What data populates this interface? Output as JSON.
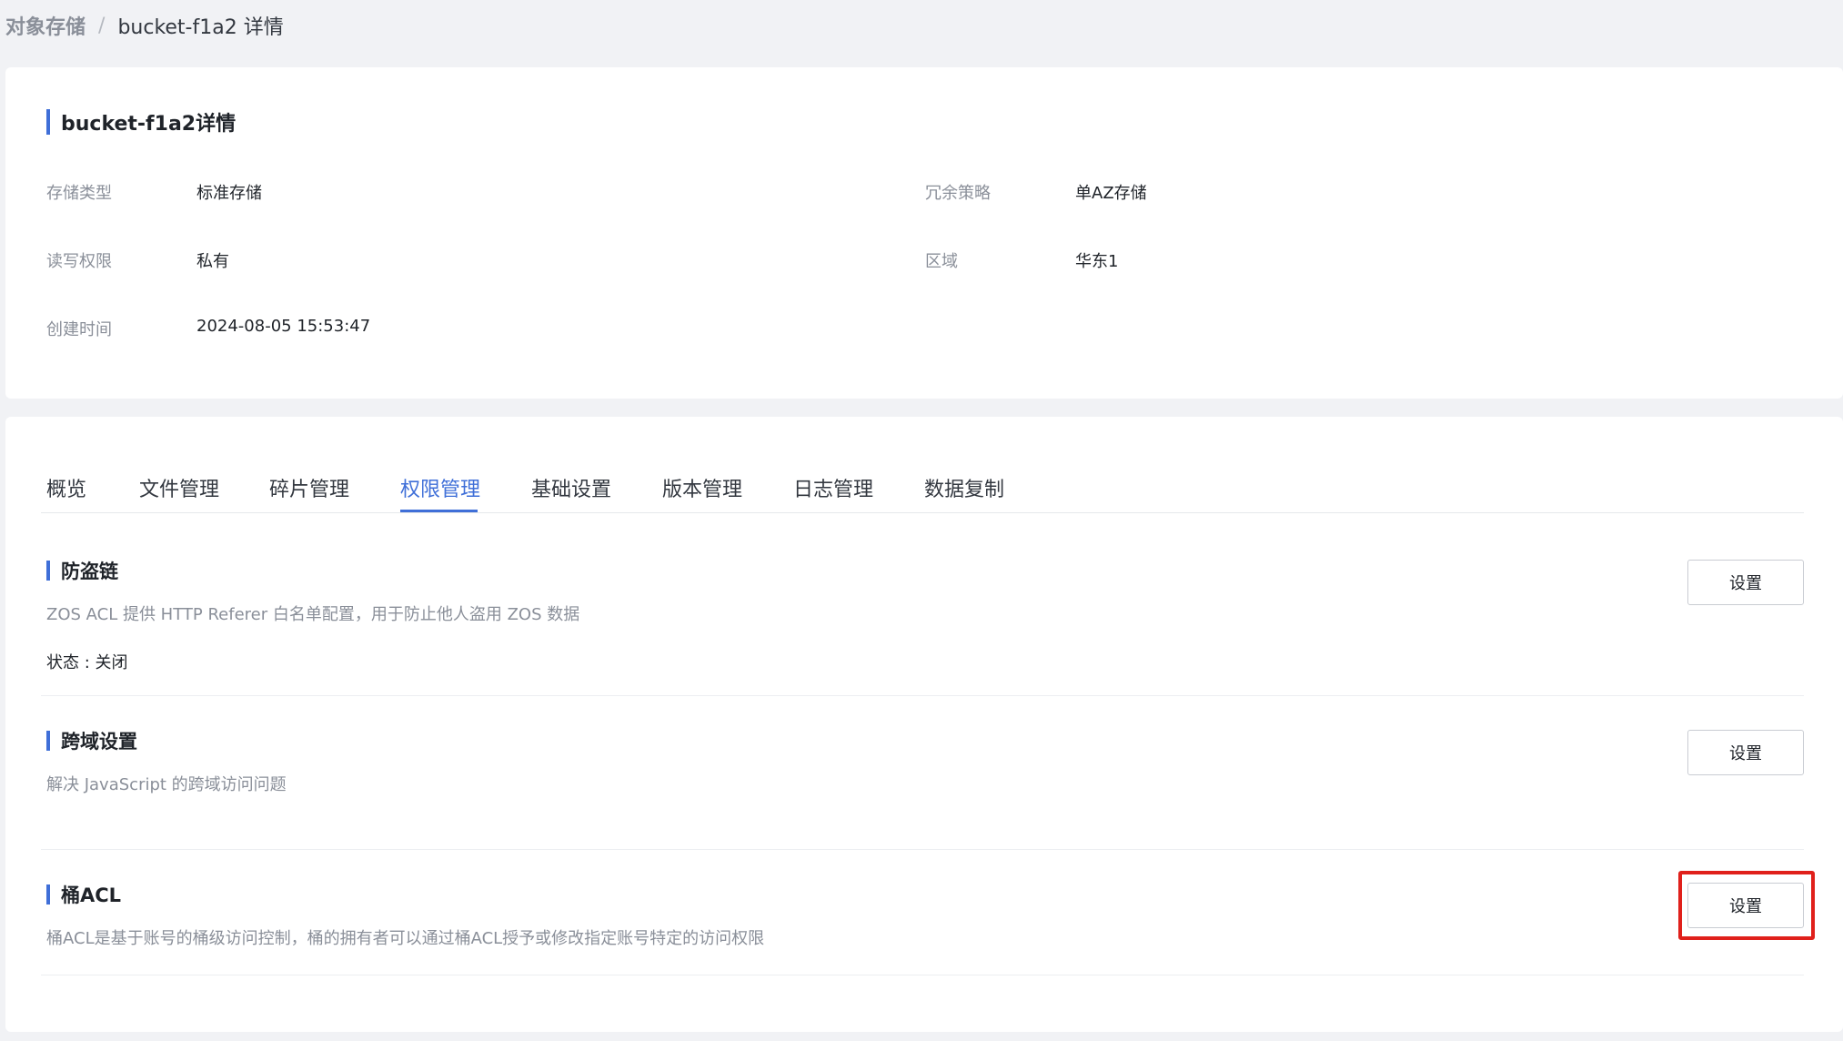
{
  "breadcrumb": {
    "root": "对象存储",
    "separator": "/",
    "current": "bucket-f1a2 详情"
  },
  "info": {
    "title": "bucket-f1a2详情",
    "storage_type_label": "存储类型",
    "storage_type_value": "标准存储",
    "redundancy_label": "冗余策略",
    "redundancy_value": "单AZ存储",
    "acl_label": "读写权限",
    "acl_value": "私有",
    "region_label": "区域",
    "region_value": "华东1",
    "created_label": "创建时间",
    "created_value": "2024-08-05 15:53:47"
  },
  "tabs": [
    {
      "label": "概览"
    },
    {
      "label": "文件管理"
    },
    {
      "label": "碎片管理"
    },
    {
      "label": "权限管理"
    },
    {
      "label": "基础设置"
    },
    {
      "label": "版本管理"
    },
    {
      "label": "日志管理"
    },
    {
      "label": "数据复制"
    }
  ],
  "active_tab": "权限管理",
  "sections": {
    "hotlink": {
      "title": "防盗链",
      "desc": "ZOS ACL 提供 HTTP Referer 白名单配置，用于防止他人盗用 ZOS 数据",
      "status": "状态 : 关闭",
      "button": "设置"
    },
    "cors": {
      "title": "跨域设置",
      "desc": "解决 JavaScript 的跨域访问问题",
      "button": "设置"
    },
    "bucket_acl": {
      "title": "桶ACL",
      "desc": "桶ACL是基于账号的桶级访问控制，桶的拥有者可以通过桶ACL授予或修改指定账号特定的访问权限",
      "button": "设置"
    }
  },
  "colors": {
    "accent": "#3f6fd8",
    "highlight": "#e0201b"
  }
}
